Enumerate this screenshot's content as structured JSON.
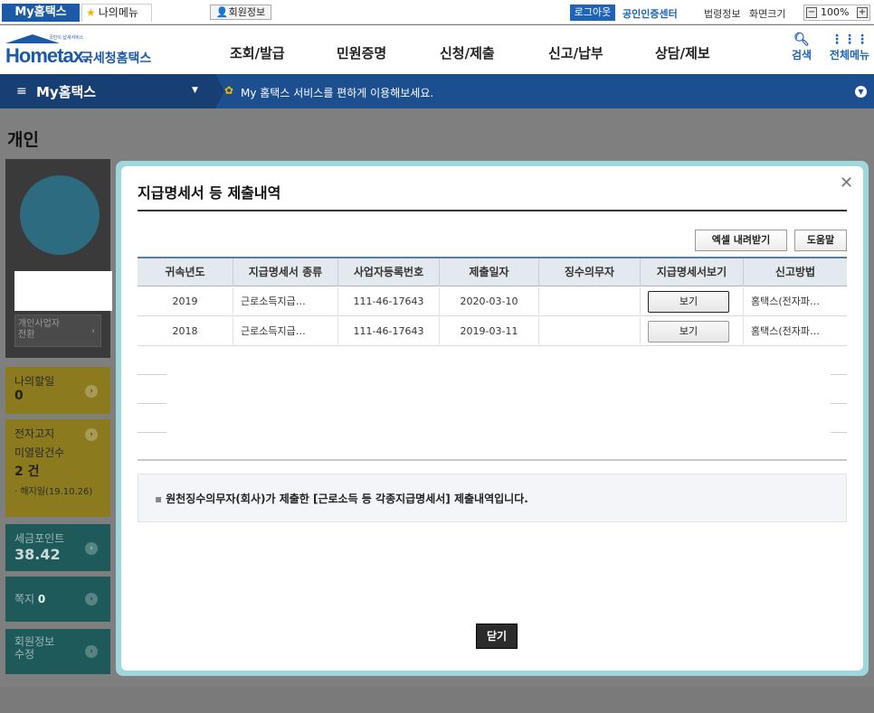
{
  "topbar": {
    "my_hometax_tab": "My홈택스",
    "my_menu_tab": "나의메뉴",
    "member_info": "회원정보",
    "logout": "로그아웃",
    "cert_center": "공인인증센터",
    "law_info": "법령정보",
    "screen_size": "화면크기",
    "zoom_minus": "−",
    "zoom_value": "100%",
    "zoom_plus": "+"
  },
  "header": {
    "logo_small": "국민이 납세서비스",
    "logo_main": "Hometax.",
    "logo_sub": "국세청홈택스",
    "gnb": [
      "조회/발급",
      "민원증명",
      "신청/제출",
      "신고/납부",
      "상담/제보"
    ],
    "search_label": "검색",
    "all_menu_label": "전체메뉴"
  },
  "navbar": {
    "title": "My홈택스",
    "message": "My 홈택스 서비스를 편하게 이용해보세요."
  },
  "page": {
    "title": "개인"
  },
  "sidebar": {
    "biz_switch": "개인사업자\n전환",
    "todo_label": "나의할일",
    "todo_count": "0",
    "notice_label": "전자고지",
    "notice_unread": "미열람건수",
    "notice_count": "2 건",
    "notice_cancel": "· 해지일(19.10.26)",
    "point_label": "세금포인트",
    "point_value": "38.42",
    "note_label": "쪽지",
    "note_count": "0",
    "member_edit": "회원정보\n수정"
  },
  "modal": {
    "title": "지급명세서 등 제출내역",
    "excel_button": "엑셀 내려받기",
    "help_button": "도움말",
    "columns": [
      "귀속년도",
      "지급명세서 종류",
      "사업자등록번호",
      "제출일자",
      "징수의무자",
      "지급명세서보기",
      "신고방법"
    ],
    "rows": [
      {
        "year": "2019",
        "type": "근로소득지급…",
        "biz_no": "111-46-17643",
        "date": "2020-03-10",
        "payer": "",
        "view": "보기",
        "method": "홈택스(전자파…"
      },
      {
        "year": "2018",
        "type": "근로소득지급…",
        "biz_no": "111-46-17643",
        "date": "2019-03-11",
        "payer": "",
        "view": "보기",
        "method": "홈택스(전자파…"
      }
    ],
    "notice": "원천징수의무자(회사)가 제출한 [근로소득 등 각종지급명세서] 제출내역입니다.",
    "close_button": "닫기"
  }
}
